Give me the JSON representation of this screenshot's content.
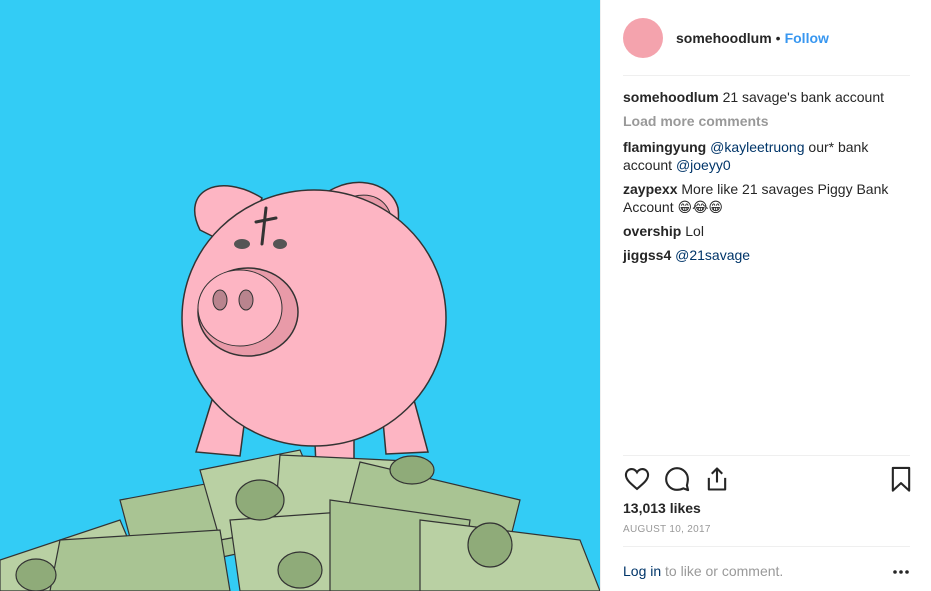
{
  "post": {
    "username": "somehoodlum",
    "separator": "•",
    "follow_label": "Follow",
    "caption_user": "somehoodlum",
    "caption_text": "21 savage's bank account",
    "load_more_label": "Load more comments",
    "comments": [
      {
        "user": "flamingyung",
        "parts": [
          {
            "t": "@kayleetruong",
            "m": true
          },
          {
            "t": " our* bank account ",
            "m": false
          },
          {
            "t": "@joeyy0",
            "m": true
          }
        ]
      },
      {
        "user": "zaypexx",
        "parts": [
          {
            "t": "More like 21 savages Piggy Bank Account 😁😂😁",
            "m": false
          }
        ]
      },
      {
        "user": "overship",
        "parts": [
          {
            "t": "Lol",
            "m": false
          }
        ]
      },
      {
        "user": "jiggss4",
        "parts": [
          {
            "t": "@21savage",
            "m": true
          }
        ]
      }
    ],
    "likes": "13,013 likes",
    "date": "August 10, 2017",
    "footer_login": "Log in",
    "footer_rest": " to like or comment."
  },
  "icons": {
    "like": "heart-icon",
    "comment": "comment-bubble-icon",
    "share": "share-icon",
    "save": "bookmark-icon",
    "more": "more-options-icon"
  },
  "colors": {
    "background_media": "#33ccf5",
    "link": "#3897f0",
    "mention": "#003569",
    "muted": "#999999",
    "avatar": "#f4a3ad",
    "pig": "#fdb5c3",
    "money": "#b9d0a3"
  }
}
